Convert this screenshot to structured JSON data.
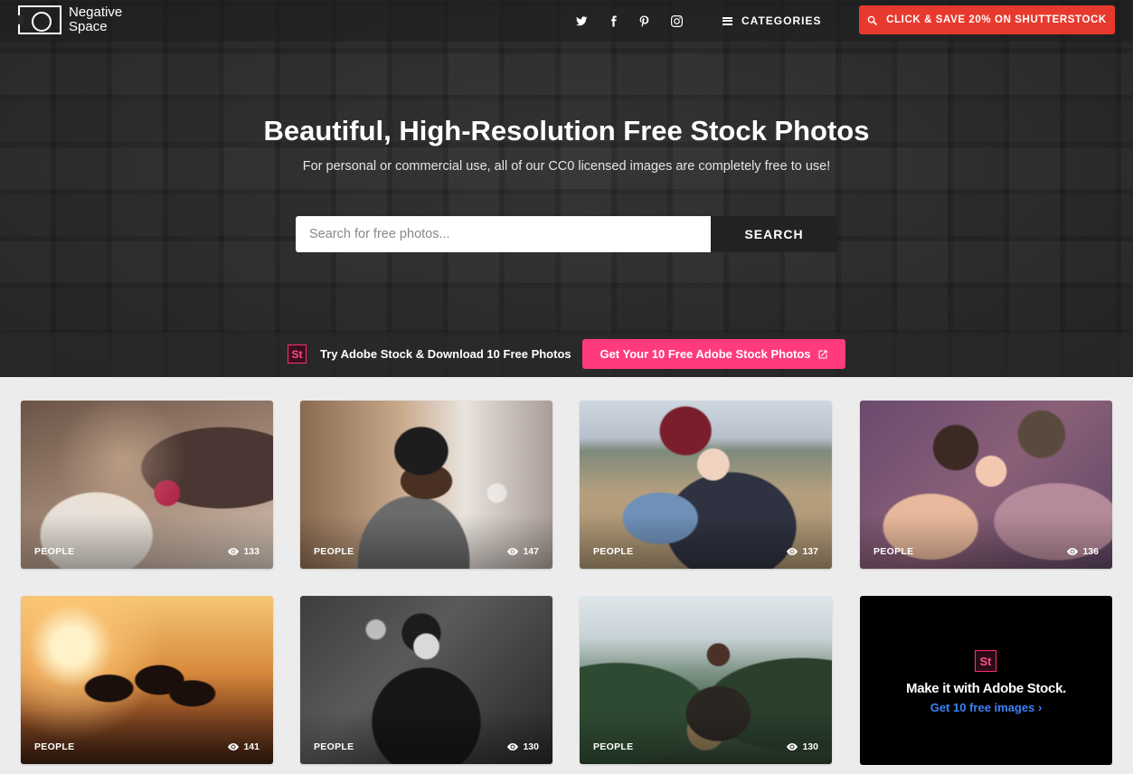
{
  "header": {
    "logo_line1": "Negative",
    "logo_line2": "Space",
    "social": [
      "twitter-icon",
      "facebook-icon",
      "pinterest-icon",
      "instagram-icon"
    ],
    "categories_label": "CATEGORIES",
    "shutterstock_label": "CLICK & SAVE 20% ON SHUTTERSTOCK"
  },
  "hero": {
    "title": "Beautiful, High-Resolution Free Stock Photos",
    "subtitle": "For personal or commercial use, all of our CC0 licensed images are completely free to use!",
    "search_placeholder": "Search for free photos...",
    "search_button": "SEARCH"
  },
  "adobe_banner": {
    "badge": "St",
    "text": "Try Adobe Stock & Download 10 Free Photos",
    "cta": "Get Your 10 Free Adobe Stock Photos"
  },
  "photos": [
    {
      "category": "PEOPLE",
      "views": "133"
    },
    {
      "category": "PEOPLE",
      "views": "147"
    },
    {
      "category": "PEOPLE",
      "views": "137"
    },
    {
      "category": "PEOPLE",
      "views": "136"
    },
    {
      "category": "PEOPLE",
      "views": "141"
    },
    {
      "category": "PEOPLE",
      "views": "130"
    },
    {
      "category": "PEOPLE",
      "views": "130"
    }
  ],
  "ad_card": {
    "badge": "St",
    "title": "Make it with Adobe Stock.",
    "link": "Get 10 free images ›"
  },
  "colors": {
    "shutterstock_red": "#e8392e",
    "adobe_pink": "#ff3b7e",
    "link_blue": "#3b82f6"
  }
}
